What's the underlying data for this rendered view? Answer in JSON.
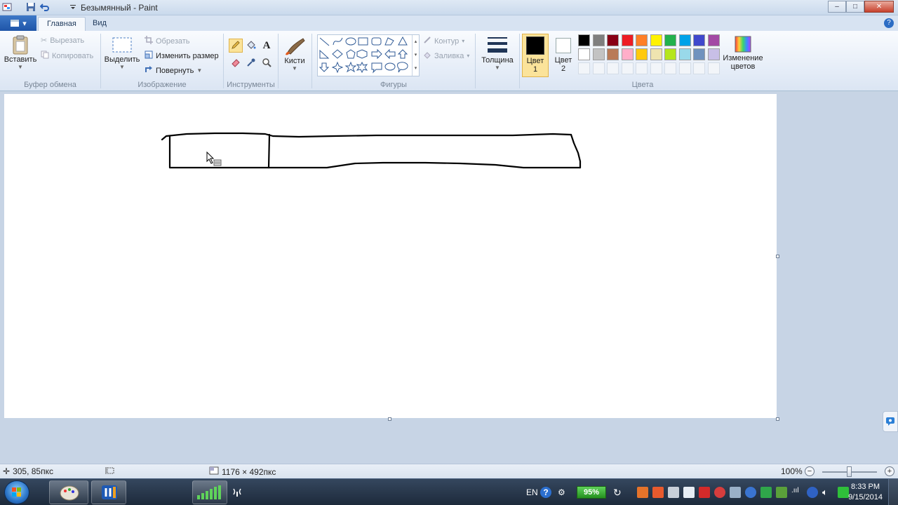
{
  "window": {
    "title": "Безымянный - Paint",
    "controls": {
      "minimize": "–",
      "maximize": "□",
      "close": "✕"
    }
  },
  "tabs": {
    "app_menu": "▾",
    "items": [
      "Главная",
      "Вид"
    ],
    "active": "Главная"
  },
  "ribbon": {
    "clipboard": {
      "paste": "Вставить",
      "cut": "Вырезать",
      "copy": "Копировать",
      "label": "Буфер обмена"
    },
    "image": {
      "select": "Выделить",
      "crop": "Обрезать",
      "resize": "Изменить размер",
      "rotate": "Повернуть",
      "label": "Изображение"
    },
    "tools": {
      "label": "Инструменты",
      "active_tool": "pencil"
    },
    "brushes": {
      "label": "Кисти"
    },
    "shapes": {
      "label": "Фигуры",
      "outline": "Контур",
      "fill": "Заливка"
    },
    "size": {
      "label": "Толщина"
    },
    "colors": {
      "color1_label": "Цвет\n1",
      "color1": "#000000",
      "color2_label": "Цвет\n2",
      "color2": "#ffffff",
      "edit_label": "Изменение цветов",
      "group_label": "Цвета",
      "palette_row1": [
        "#000000",
        "#7f7f7f",
        "#880015",
        "#ed1c24",
        "#ff7f27",
        "#fff200",
        "#22b14c",
        "#00a2e8",
        "#3f48cc",
        "#a349a4"
      ],
      "palette_row2": [
        "#ffffff",
        "#c3c3c3",
        "#b97a57",
        "#ffaec9",
        "#ffc90e",
        "#efe4b0",
        "#b5e61d",
        "#99d9ea",
        "#7092be",
        "#c8bfe7"
      ]
    }
  },
  "status": {
    "cursor_pos": "305, 85пкс",
    "canvas_size": "1176 × 492пкс",
    "zoom": "100%"
  },
  "taskbar": {
    "language": "EN",
    "battery": "95%",
    "time": "8:33 PM",
    "date": "9/15/2014"
  }
}
